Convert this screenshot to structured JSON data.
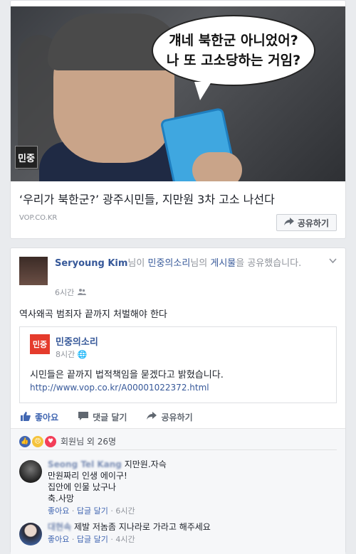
{
  "link_card": {
    "bubble_line1": "걔네 북한군 아니었어?",
    "bubble_line2": "나 또 고소당하는 거임?",
    "logo": "민중",
    "title": "‘우리가 북한군?’ 광주시민들, 지만원 3차 고소 나선다",
    "domain": "VOP.CO.KR",
    "share_label": "공유하기"
  },
  "post": {
    "author": "Seryoung Kim",
    "text_mid1": "님이 ",
    "page": "민중의소리",
    "text_mid2": "님의 ",
    "post_word": "게시물",
    "text_end": "을 공유했습니다.",
    "time": "6시간",
    "audience_icon": "friends-icon",
    "message": "역사왜곡 범죄자 끝까지 처벌해야 한다",
    "shared": {
      "logo": "민중",
      "name": "민중의소리",
      "time": "8시간",
      "privacy_icon": "globe-icon",
      "text": "시민들은 끝까지 법적책임을 묻겠다고 밝혔습니다.",
      "url": "http://www.vop.co.kr/A00001022372.html"
    },
    "actions": {
      "like": "좋아요",
      "comment": "댓글 달기",
      "share": "공유하기"
    },
    "reactions": {
      "summary": "회원님 외 26명"
    },
    "comments": [
      {
        "name": "Seong Tel Kang",
        "lines": [
          "지만원.자슥",
          "만원짜리 인생 에이구!",
          "집안에 인물 났구나",
          "축.사망"
        ],
        "like": "좋아요",
        "reply": "답글 달기",
        "time": "6시간"
      },
      {
        "name": "대현속",
        "lines": [
          "제발 저놈좀 지나라로 가라고 해주세요"
        ],
        "like": "좋아요",
        "reply": "답글 달기",
        "time": "4시간"
      }
    ]
  },
  "colors": {
    "link": "#365899",
    "like_blue": "#4267b2",
    "brand_red": "#e53b2c"
  }
}
